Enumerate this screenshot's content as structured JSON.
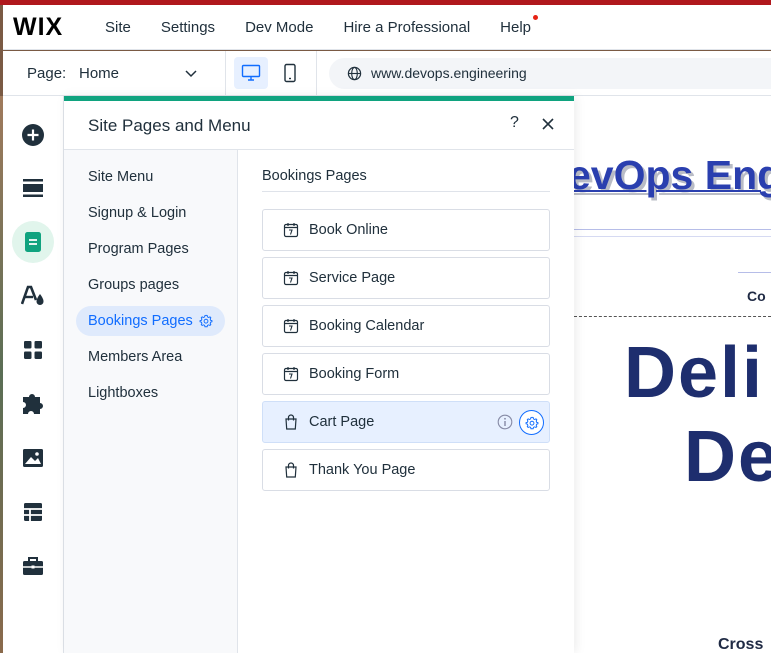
{
  "topbar": {
    "logo": "WIX",
    "nav": [
      {
        "label": "Site"
      },
      {
        "label": "Settings"
      },
      {
        "label": "Dev Mode"
      },
      {
        "label": "Hire a Professional"
      },
      {
        "label": "Help",
        "has_notification": true
      }
    ]
  },
  "secondbar": {
    "page_label": "Page:",
    "page_value": "Home",
    "device": "desktop",
    "url": "www.devops.engineering"
  },
  "rail": {
    "items": [
      {
        "icon": "add-icon"
      },
      {
        "icon": "sections-icon"
      },
      {
        "icon": "pages-icon",
        "active": true
      },
      {
        "icon": "design-icon"
      },
      {
        "icon": "apps-icon"
      },
      {
        "icon": "app-market-icon"
      },
      {
        "icon": "media-icon"
      },
      {
        "icon": "cms-icon"
      },
      {
        "icon": "business-icon"
      }
    ]
  },
  "panel": {
    "title": "Site Pages and Menu",
    "help": "?",
    "side_menu": [
      {
        "label": "Site Menu"
      },
      {
        "label": "Signup & Login"
      },
      {
        "label": "Program Pages"
      },
      {
        "label": "Groups pages"
      },
      {
        "label": "Bookings Pages",
        "active": true
      },
      {
        "label": "Members Area"
      },
      {
        "label": "Lightboxes"
      }
    ],
    "section_title": "Bookings Pages",
    "pages": [
      {
        "label": "Book Online",
        "icon": "calendar-icon"
      },
      {
        "label": "Service Page",
        "icon": "calendar-icon"
      },
      {
        "label": "Booking Calendar",
        "icon": "calendar-icon"
      },
      {
        "label": "Booking Form",
        "icon": "calendar-icon"
      },
      {
        "label": "Cart Page",
        "icon": "shopping-bag-icon",
        "selected": true
      },
      {
        "label": "Thank You Page",
        "icon": "shopping-bag-icon"
      }
    ]
  },
  "canvas": {
    "site_title": "evOps Eng",
    "nav_fragment": "Co",
    "headline_line1": "Deli",
    "headline_line2": "De",
    "footer_fragment": "Cross"
  },
  "colors": {
    "accent": "#116dff",
    "panel_accent": "#10a37f",
    "active_rail_bg": "#e1f5ec",
    "selected_row_bg": "#e7f0ff"
  }
}
